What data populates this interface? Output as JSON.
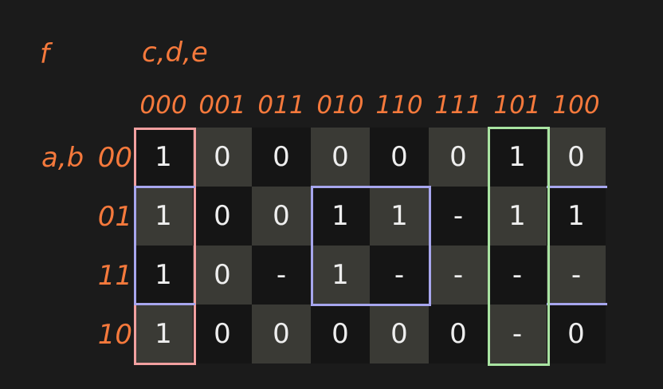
{
  "function_label": "f",
  "col_vars_label": "c,d,e",
  "row_vars_label": "a,b",
  "col_headers": [
    "000",
    "001",
    "011",
    "010",
    "110",
    "111",
    "101",
    "100"
  ],
  "row_headers": [
    "00",
    "01",
    "11",
    "10"
  ],
  "cells": [
    [
      "1",
      "0",
      "0",
      "0",
      "0",
      "0",
      "1",
      "0"
    ],
    [
      "1",
      "0",
      "0",
      "1",
      "1",
      "-",
      "1",
      "1"
    ],
    [
      "1",
      "0",
      "-",
      "1",
      "-",
      "-",
      "-",
      "-"
    ],
    [
      "1",
      "0",
      "0",
      "0",
      "0",
      "0",
      "-",
      "0"
    ]
  ],
  "colors": {
    "background": "#1b1b1b",
    "label": "#f5793c",
    "cell_light": "#3a3a35",
    "cell_dark": "#151515",
    "cell_text": "#eeeeee",
    "group_pink": "#f2a0a0",
    "group_blue": "#a7a6ee",
    "group_green": "#a9e4a2"
  },
  "groups": [
    {
      "color": "pink",
      "rows": [
        0,
        1,
        2,
        3
      ],
      "cols": [
        0
      ]
    },
    {
      "color": "blue",
      "rows": [
        1,
        2
      ],
      "cols": [
        0,
        7
      ],
      "wraps": "horizontal"
    },
    {
      "color": "blue",
      "rows": [
        1,
        2
      ],
      "cols": [
        3,
        4
      ]
    },
    {
      "color": "green",
      "rows": [
        0,
        1,
        2,
        3
      ],
      "cols": [
        6
      ]
    }
  ]
}
